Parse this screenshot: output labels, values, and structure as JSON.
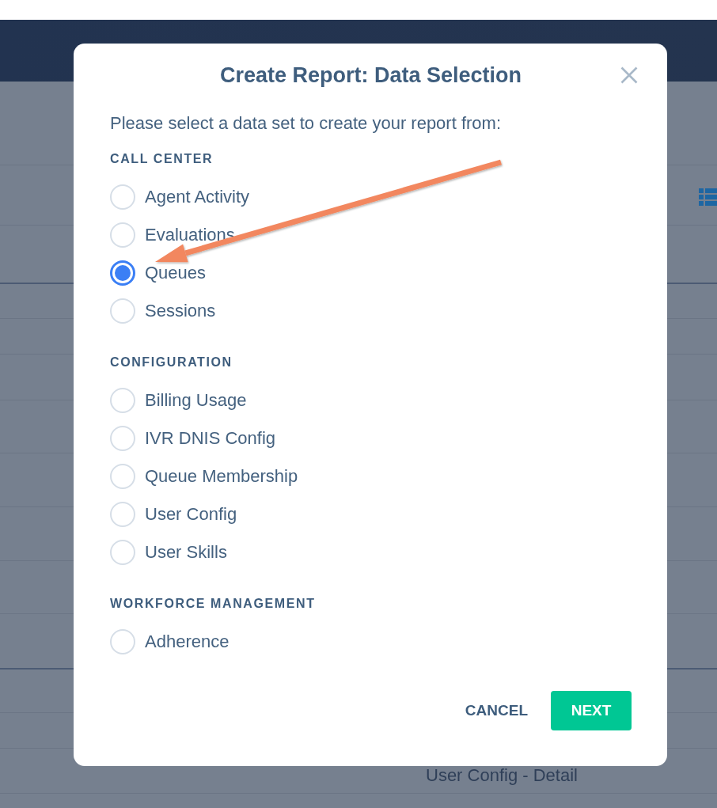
{
  "background": {
    "row_text": "User Config - Detail"
  },
  "dialog": {
    "title": "Create Report: Data Selection",
    "prompt": "Please select a data set to create your report from:",
    "groups": [
      {
        "heading": "CALL CENTER",
        "options": [
          {
            "label": "Agent Activity",
            "selected": false
          },
          {
            "label": "Evaluations",
            "selected": false
          },
          {
            "label": "Queues",
            "selected": true
          },
          {
            "label": "Sessions",
            "selected": false
          }
        ]
      },
      {
        "heading": "CONFIGURATION",
        "options": [
          {
            "label": "Billing Usage",
            "selected": false
          },
          {
            "label": "IVR DNIS Config",
            "selected": false
          },
          {
            "label": "Queue Membership",
            "selected": false
          },
          {
            "label": "User Config",
            "selected": false
          },
          {
            "label": "User Skills",
            "selected": false
          }
        ]
      },
      {
        "heading": "WORKFORCE MANAGEMENT",
        "options": [
          {
            "label": "Adherence",
            "selected": false
          }
        ]
      }
    ],
    "buttons": [
      {
        "label": "CANCEL",
        "kind": "text"
      },
      {
        "label": "NEXT",
        "kind": "primary"
      }
    ]
  }
}
